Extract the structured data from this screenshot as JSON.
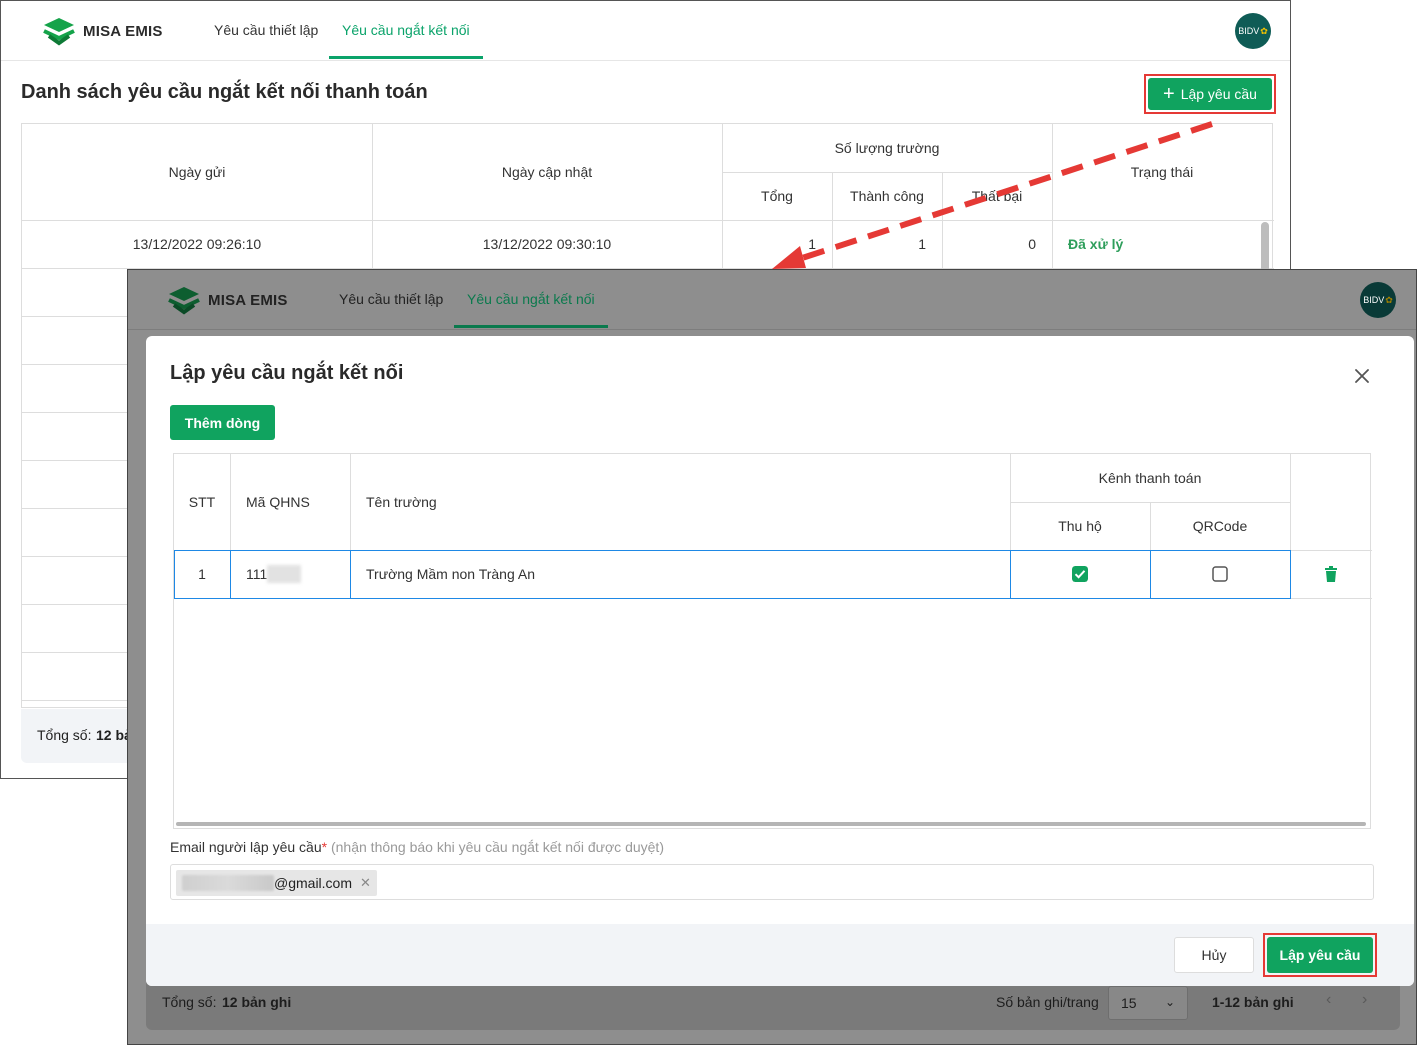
{
  "app": {
    "brand": "MISA EMIS",
    "tabs": [
      "Yêu cầu thiết lập",
      "Yêu cầu ngắt kết nối"
    ],
    "avatar_text": "BIDV"
  },
  "background_page": {
    "title": "Danh sách yêu cầu ngắt kết nối thanh toán",
    "create_button_label": "Lập yêu cầu",
    "columns": {
      "sent_date": "Ngày gửi",
      "updated_date": "Ngày cập nhật",
      "school_count": "Số lượng trường",
      "total": "Tổng",
      "success": "Thành công",
      "failed": "Thất bại",
      "status": "Trạng thái"
    },
    "rows": [
      {
        "sent_date": "13/12/2022 09:26:10",
        "updated_date": "13/12/2022 09:30:10",
        "total": "1",
        "success": "1",
        "failed": "0",
        "status": "Đã xử lý"
      }
    ],
    "footer_total_label": "Tổng số:",
    "footer_total_value": "12 bả"
  },
  "modal": {
    "title": "Lập yêu cầu ngắt kết nối",
    "add_row_label": "Thêm dòng",
    "columns": {
      "stt": "STT",
      "code": "Mã QHNS",
      "school": "Tên trường",
      "channel": "Kênh thanh toán",
      "thu_ho": "Thu hộ",
      "qrcode": "QRCode"
    },
    "rows": [
      {
        "stt": "1",
        "code": "111",
        "school": "Trường Mầm non Tràng An",
        "thu_ho": true,
        "qrcode": false
      }
    ],
    "email_label": "Email người lập yêu cầu",
    "email_required": "*",
    "email_hint": "(nhận thông báo khi yêu cầu ngắt kết nối được duyệt)",
    "email_chip": "@gmail.com",
    "cancel_label": "Hủy",
    "submit_label": "Lập yêu cầu"
  },
  "foreground_footer": {
    "total_label": "Tổng số:",
    "total_value": "12 bản ghi",
    "per_page_label": "Số bản ghi/trang",
    "per_page_value": "15",
    "range": "1-12 bản ghi"
  },
  "colors": {
    "brand_green": "#10a35f",
    "highlight_red": "#e53935",
    "status_green": "#2e9e5b"
  }
}
